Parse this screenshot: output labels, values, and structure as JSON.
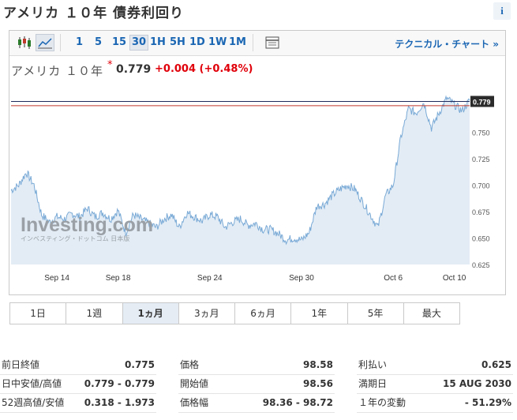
{
  "page": {
    "title": "アメリカ １０年 債券利回り",
    "info_icon": "info-icon"
  },
  "toolbar": {
    "timeframes": [
      {
        "label": "1",
        "active": false
      },
      {
        "label": "5",
        "active": false
      },
      {
        "label": "15",
        "active": false
      },
      {
        "label": "30",
        "active": true
      },
      {
        "label": "1H",
        "active": false
      },
      {
        "label": "5H",
        "active": false
      },
      {
        "label": "1D",
        "active": false
      },
      {
        "label": "1W",
        "active": false
      },
      {
        "label": "1M",
        "active": false
      }
    ],
    "technical_link": "テクニカル・チャート »",
    "icons": [
      "candlestick-icon",
      "line-chart-icon",
      "table-icon"
    ]
  },
  "quote": {
    "name": "アメリカ １０年",
    "price": "0.779",
    "change": "+0.004",
    "change_pct": "(+0.48%)"
  },
  "colors": {
    "line": "#7aaad6",
    "area": "#e3ecf5",
    "accent": "#1a66b3",
    "negative": "#e0000a",
    "current_line": "#1f2a5c",
    "prev_close_line": "#c0392b"
  },
  "chart_data": {
    "type": "area",
    "x_start": "Sep 11",
    "x_end": "Oct 10",
    "x_ticks": [
      {
        "label": "Sep 14",
        "x": 3
      },
      {
        "label": "Sep 18",
        "x": 7
      },
      {
        "label": "Sep 24",
        "x": 13
      },
      {
        "label": "Sep 30",
        "x": 19
      },
      {
        "label": "Oct 6",
        "x": 25
      },
      {
        "label": "Oct 10",
        "x": 29
      }
    ],
    "y_ticks": [
      "0.750",
      "0.725",
      "0.700",
      "0.675",
      "0.650",
      "0.625"
    ],
    "ylim": [
      0.625,
      0.798
    ],
    "current_value": 0.779,
    "current_label": "0.779",
    "prev_close": 0.775,
    "watermark": "Investing.com",
    "watermark_sub": "インベスティング・ドットコム 日本版",
    "x": [
      0,
      0.5,
      1,
      1.5,
      2,
      2.5,
      3,
      3.5,
      4,
      4.5,
      5,
      5.5,
      6,
      6.5,
      7,
      7.5,
      8,
      8.5,
      9,
      9.5,
      10,
      10.5,
      11,
      11.5,
      12,
      12.5,
      13,
      13.5,
      14,
      14.5,
      15,
      15.5,
      16,
      16.5,
      17,
      17.5,
      18,
      18.5,
      19,
      19.5,
      20,
      20.5,
      21,
      21.5,
      22,
      22.5,
      23,
      23.5,
      24,
      24.5,
      25,
      25.5,
      26,
      26.5,
      27,
      27.5,
      28,
      28.5,
      29,
      29.5,
      30
    ],
    "values": [
      0.695,
      0.7,
      0.712,
      0.7,
      0.672,
      0.665,
      0.67,
      0.668,
      0.673,
      0.67,
      0.678,
      0.67,
      0.674,
      0.668,
      0.676,
      0.655,
      0.672,
      0.668,
      0.664,
      0.66,
      0.668,
      0.672,
      0.66,
      0.674,
      0.67,
      0.666,
      0.672,
      0.67,
      0.66,
      0.665,
      0.668,
      0.662,
      0.664,
      0.658,
      0.658,
      0.654,
      0.648,
      0.65,
      0.648,
      0.655,
      0.68,
      0.682,
      0.69,
      0.696,
      0.7,
      0.696,
      0.684,
      0.672,
      0.66,
      0.69,
      0.7,
      0.745,
      0.772,
      0.768,
      0.778,
      0.754,
      0.768,
      0.782,
      0.776,
      0.77,
      0.78
    ],
    "x_label": "",
    "y_label": "",
    "grid": false,
    "legend": "none"
  },
  "ranges": [
    {
      "label": "1日",
      "active": false
    },
    {
      "label": "1週",
      "active": false
    },
    {
      "label": "1ヵ月",
      "active": true
    },
    {
      "label": "3ヵ月",
      "active": false
    },
    {
      "label": "6ヵ月",
      "active": false
    },
    {
      "label": "1年",
      "active": false
    },
    {
      "label": "5年",
      "active": false
    },
    {
      "label": "最大",
      "active": false
    }
  ],
  "stats": [
    [
      {
        "label": "前日終値",
        "value": "0.775"
      },
      {
        "label": "日中安値/高値",
        "value": "0.779 - 0.779"
      },
      {
        "label": "52週高値/安値",
        "value": "0.318 - 1.973"
      }
    ],
    [
      {
        "label": "価格",
        "value": "98.58"
      },
      {
        "label": "開始値",
        "value": "98.56"
      },
      {
        "label": "価格幅",
        "value": "98.36 - 98.72"
      }
    ],
    [
      {
        "label": "利払い",
        "value": "0.625"
      },
      {
        "label": "満期日",
        "value": "15 AUG 2030"
      },
      {
        "label": "１年の変動",
        "value": "- 51.29%"
      }
    ]
  ]
}
